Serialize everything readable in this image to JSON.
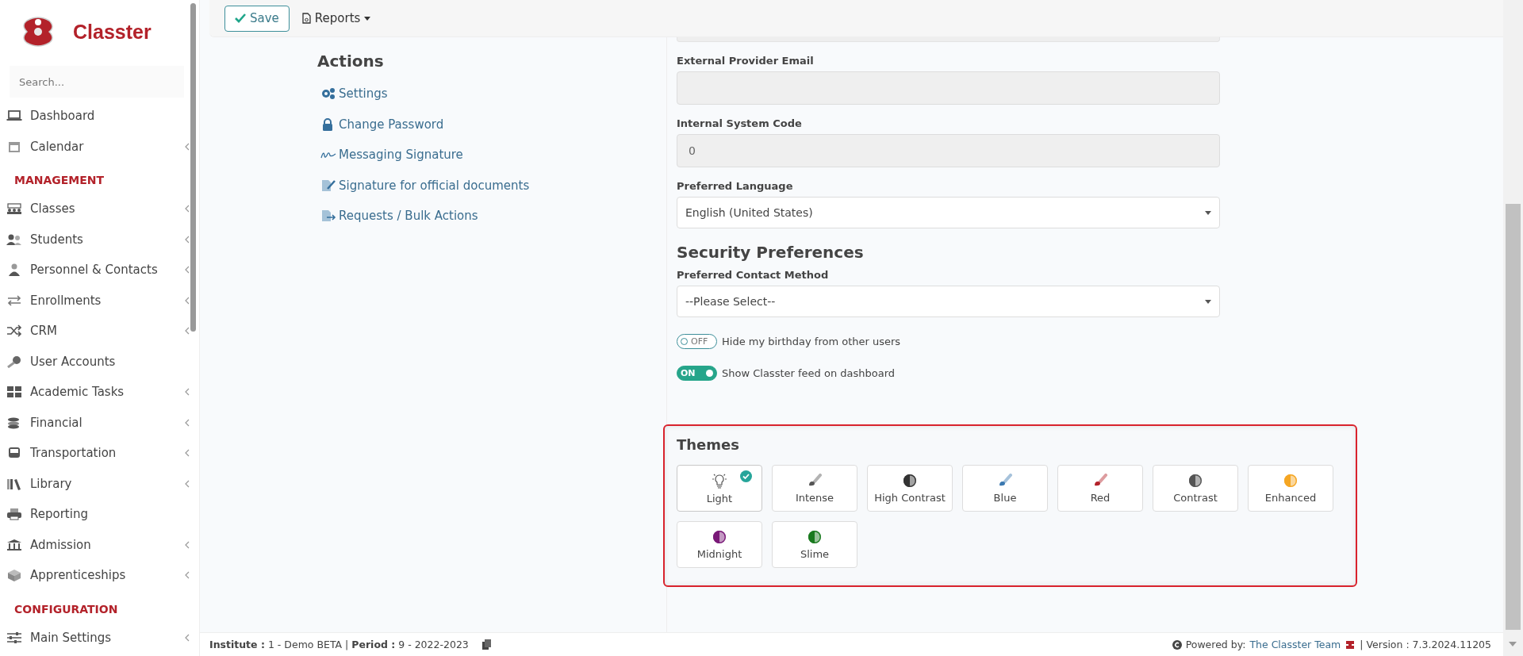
{
  "brand": {
    "name": "Classter"
  },
  "sidebar": {
    "search": {
      "placeholder": "Search..."
    },
    "sections": [
      {
        "items": [
          {
            "label": "Dashboard",
            "expandable": false
          },
          {
            "label": "Calendar",
            "expandable": true
          }
        ]
      },
      {
        "title": "MANAGEMENT",
        "items": [
          {
            "label": "Classes",
            "expandable": true
          },
          {
            "label": "Students",
            "expandable": true
          },
          {
            "label": "Personnel & Contacts",
            "expandable": true
          },
          {
            "label": "Enrollments",
            "expandable": true
          },
          {
            "label": "CRM",
            "expandable": true
          },
          {
            "label": "User Accounts",
            "expandable": false
          },
          {
            "label": "Academic Tasks",
            "expandable": true
          },
          {
            "label": "Financial",
            "expandable": true
          },
          {
            "label": "Transportation",
            "expandable": true
          },
          {
            "label": "Library",
            "expandable": true
          },
          {
            "label": "Reporting",
            "expandable": false
          },
          {
            "label": "Admission",
            "expandable": true
          },
          {
            "label": "Apprenticeships",
            "expandable": true
          }
        ]
      },
      {
        "title": "CONFIGURATION",
        "items": [
          {
            "label": "Main Settings",
            "expandable": true
          }
        ]
      }
    ]
  },
  "toolbar": {
    "save": "Save",
    "reports": "Reports"
  },
  "actions": {
    "title": "Actions",
    "links": [
      {
        "label": "Settings"
      },
      {
        "label": "Change Password"
      },
      {
        "label": "Messaging Signature"
      },
      {
        "label": "Signature for official documents"
      },
      {
        "label": "Requests / Bulk Actions"
      }
    ]
  },
  "form": {
    "fields": [
      {
        "label": "External Provider Email",
        "kind": "text",
        "disabled": true
      },
      {
        "label": "Internal System Code",
        "kind": "text",
        "value": "0",
        "disabled": true
      },
      {
        "label": "Preferred Language",
        "kind": "select",
        "value": "English (United States)",
        "disabled": false
      }
    ],
    "security": {
      "title": "Security Preferences",
      "fields": [
        {
          "label": "Preferred Contact Method",
          "kind": "select",
          "value": "--Please Select--",
          "disabled": false
        }
      ],
      "toggles": [
        {
          "label": "Hide my birthday from other users",
          "on": false,
          "state_label": "OFF"
        },
        {
          "label": "Show Classter feed on dashboard",
          "on": true,
          "state_label": "ON"
        }
      ]
    }
  },
  "themes": {
    "title": "Themes",
    "items": [
      {
        "label": "Light",
        "kind": "bulb",
        "selected": true
      },
      {
        "label": "Intense",
        "kind": "brush",
        "color": "#555555",
        "selected": false
      },
      {
        "label": "High Contrast",
        "kind": "half",
        "color": "#333333",
        "selected": false
      },
      {
        "label": "Blue",
        "kind": "brush",
        "color": "#3a78b0",
        "selected": false
      },
      {
        "label": "Red",
        "kind": "brush",
        "color": "#b3222a",
        "selected": false
      },
      {
        "label": "Contrast",
        "kind": "half",
        "color": "#555555",
        "selected": false
      },
      {
        "label": "Enhanced",
        "kind": "half",
        "color": "#f5a623",
        "selected": false
      },
      {
        "label": "Midnight",
        "kind": "half",
        "color": "#7a1a78",
        "selected": false
      },
      {
        "label": "Slime",
        "kind": "half",
        "color": "#1a7a1f",
        "selected": false
      }
    ]
  },
  "footer": {
    "info": "**Institute :** 1 - Demo BETA | **Period :** 9 - 2022-2023",
    "powered": "Powered by:",
    "team": "The Classter Team",
    "version": "| Version : 7.3.2024.11205"
  }
}
